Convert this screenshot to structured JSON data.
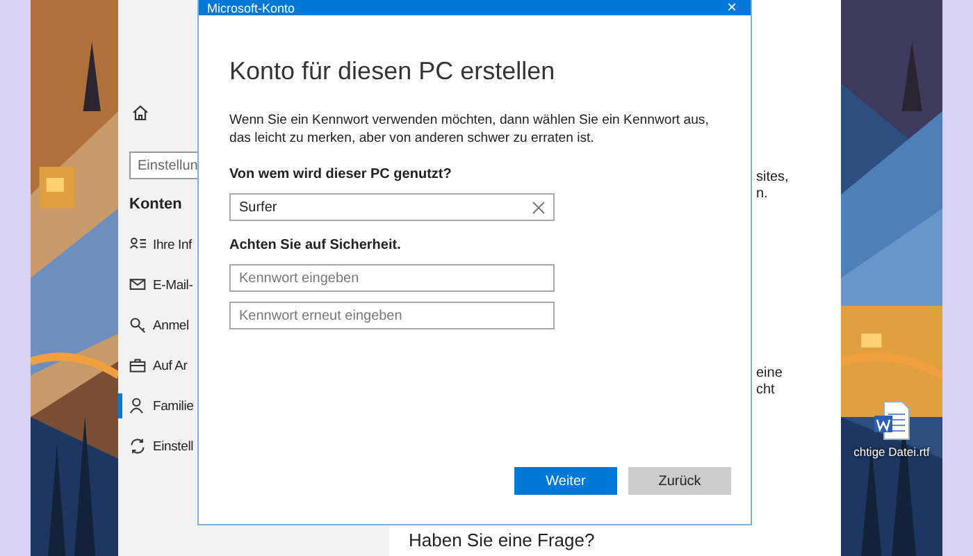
{
  "desktop": {
    "icon_label": "chtige Datei.rtf"
  },
  "settings": {
    "search": {
      "placeholder": "Einstellun"
    },
    "section": "Konten",
    "nav": [
      {
        "label": "Ihre Inf",
        "kind": "info",
        "selected": false
      },
      {
        "label": "E-Mail-",
        "kind": "mail",
        "selected": false
      },
      {
        "label": "Anmel",
        "kind": "key",
        "selected": false
      },
      {
        "label": "Auf Ar",
        "kind": "briefcase",
        "selected": false
      },
      {
        "label": "Familie",
        "kind": "person",
        "selected": true
      },
      {
        "label": "Einstell",
        "kind": "sync",
        "selected": false
      }
    ],
    "content": {
      "fragments": [
        [
          "sites,",
          "n."
        ],
        [
          "eine",
          "cht"
        ]
      ],
      "heading": "Haben Sie eine Frage?"
    }
  },
  "dialog": {
    "title": "Microsoft-Konto",
    "close": "×",
    "heading": "Konto für diesen PC erstellen",
    "intro": "Wenn Sie ein Kennwort verwenden möchten, dann wählen Sie ein Kennwort aus, das leicht zu merken, aber von anderen schwer zu erraten ist.",
    "name_label": "Von wem wird dieser PC genutzt?",
    "name_value": "Surfer",
    "security_label": "Achten Sie auf Sicherheit.",
    "password_fields": [
      {
        "placeholder": "Kennwort eingeben"
      },
      {
        "placeholder": "Kennwort erneut eingeben"
      }
    ],
    "buttons": [
      {
        "label": "Weiter",
        "kind": "primary"
      },
      {
        "label": "Zurück",
        "kind": "secondary"
      }
    ]
  }
}
